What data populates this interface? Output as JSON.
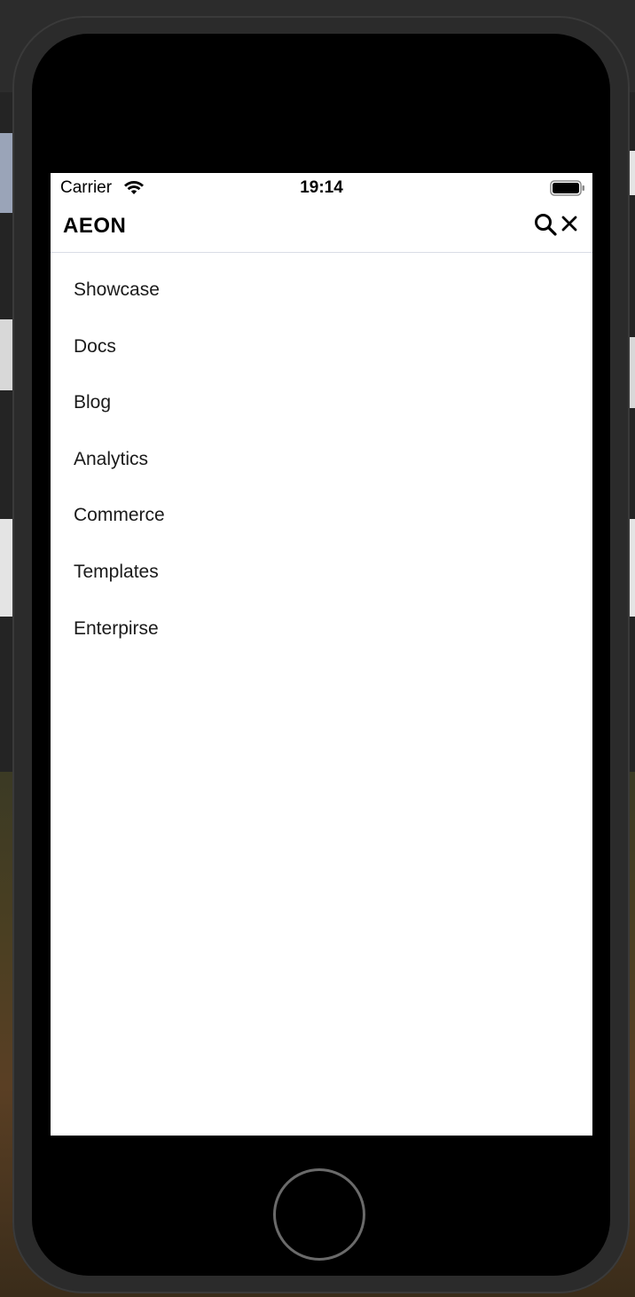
{
  "status_bar": {
    "carrier": "Carrier",
    "time": "19:14",
    "wifi_icon": "wifi-icon",
    "battery_icon": "battery-icon"
  },
  "nav": {
    "brand": "AEON",
    "search_icon": "search-icon",
    "close_icon": "close-icon"
  },
  "menu": {
    "items": [
      {
        "label": "Showcase"
      },
      {
        "label": "Docs"
      },
      {
        "label": "Blog"
      },
      {
        "label": "Analytics"
      },
      {
        "label": "Commerce"
      },
      {
        "label": "Templates"
      },
      {
        "label": "Enterpirse"
      }
    ]
  },
  "colors": {
    "screen_background": "#ffffff",
    "divider": "#d9dde6",
    "text": "#1a1a1a",
    "device_bezel": "#000000"
  }
}
